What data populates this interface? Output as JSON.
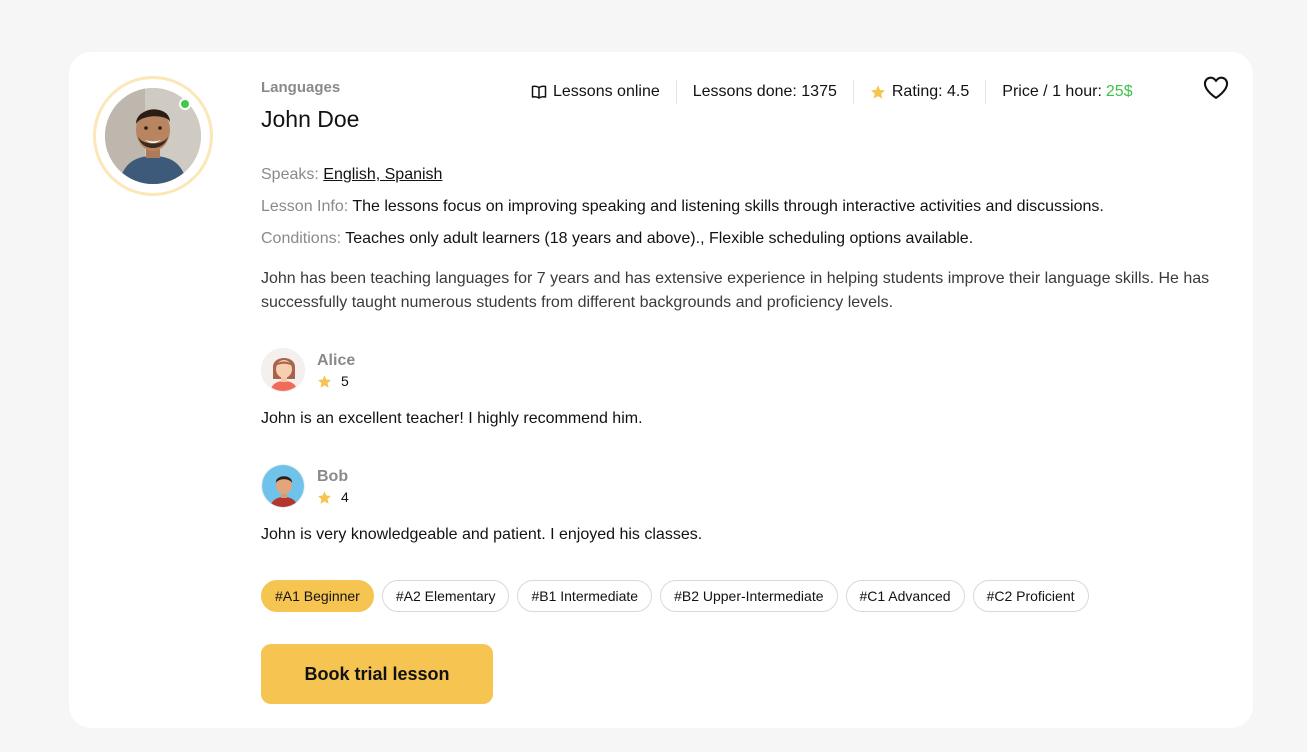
{
  "teacher": {
    "category": "Languages",
    "name": "John Doe",
    "online": true
  },
  "stats": {
    "lessons_online": "Lessons online",
    "lessons_done_label": "Lessons done:",
    "lessons_done_value": "1375",
    "rating_label": "Rating:",
    "rating_value": "4.5",
    "price_label": "Price / 1 hour:",
    "price_value": "25$"
  },
  "info": {
    "speaks_label": "Speaks:",
    "speaks_value": "English, Spanish",
    "lesson_info_label": "Lesson Info:",
    "lesson_info_value": "The lessons focus on improving speaking and listening skills through interactive activities and discussions.",
    "conditions_label": "Conditions:",
    "conditions_value": "Teaches only adult learners (18 years and above)., Flexible scheduling options available."
  },
  "bio": "John has been teaching languages for 7 years and has extensive experience in helping students improve their language skills. He has successfully taught numerous students from different backgrounds and proficiency levels.",
  "reviews": [
    {
      "name": "Alice",
      "rating": "5",
      "text": "John is an excellent teacher! I highly recommend him."
    },
    {
      "name": "Bob",
      "rating": "4",
      "text": "John is very knowledgeable and patient. I enjoyed his classes."
    }
  ],
  "levels": [
    {
      "label": "#A1 Beginner",
      "active": true
    },
    {
      "label": "#A2 Elementary",
      "active": false
    },
    {
      "label": "#B1 Intermediate",
      "active": false
    },
    {
      "label": "#B2 Upper-Intermediate",
      "active": false
    },
    {
      "label": "#C1 Advanced",
      "active": false
    },
    {
      "label": "#C2 Proficient",
      "active": false
    }
  ],
  "book_button": "Book trial lesson",
  "colors": {
    "accent": "#f5c451",
    "price": "#3fc24a",
    "online": "#40c945",
    "muted_label": "#8a8a8a",
    "star": "#f5c451"
  },
  "icons": {
    "book": "open-book-icon",
    "star": "star-icon",
    "heart": "heart-outline-icon"
  }
}
